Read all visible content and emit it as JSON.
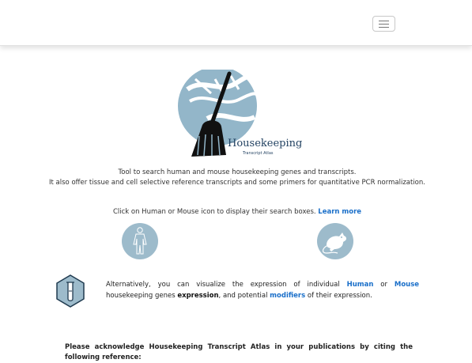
{
  "navbar": {
    "toggle_icon": "hamburger-menu-icon"
  },
  "logo": {
    "title": "Housekeeping",
    "subtitle": "Transcript Atlas",
    "colors": {
      "circle": "#93b6c9",
      "broom": "#111111",
      "helix": "#ffffff"
    }
  },
  "intro": {
    "line1": "Tool to search human and mouse housekeeping genes and transcripts.",
    "line2": "It also offer tissue and cell selective reference transcripts and some primers for quantitative PCR normalization."
  },
  "click": {
    "text": "Click on Human or Mouse icon to display their search boxes.",
    "learn_more": "Learn more"
  },
  "species": {
    "human_icon": "human-body-icon",
    "mouse_icon": "mouse-icon"
  },
  "alternative": {
    "part1": "Alternatively, you can visualize the expression of individual",
    "human": "Human",
    "or": "or",
    "mouse": "Mouse",
    "part2": "housekeeping genes",
    "expression": "expression",
    "part3": ", and potential",
    "modifiers": "modifiers",
    "part4": "of their expression.",
    "icon": "test-tube-hexagon-icon"
  },
  "acknowledge": {
    "text": "Please acknowledge Housekeeping Transcript Atlas in your publications by citing the following reference:"
  },
  "colors": {
    "link": "#1a6fc9",
    "icon_bg": "#9dbbcb",
    "hex_fill": "#9dbbcb",
    "hex_stroke": "#1f3a4f"
  }
}
